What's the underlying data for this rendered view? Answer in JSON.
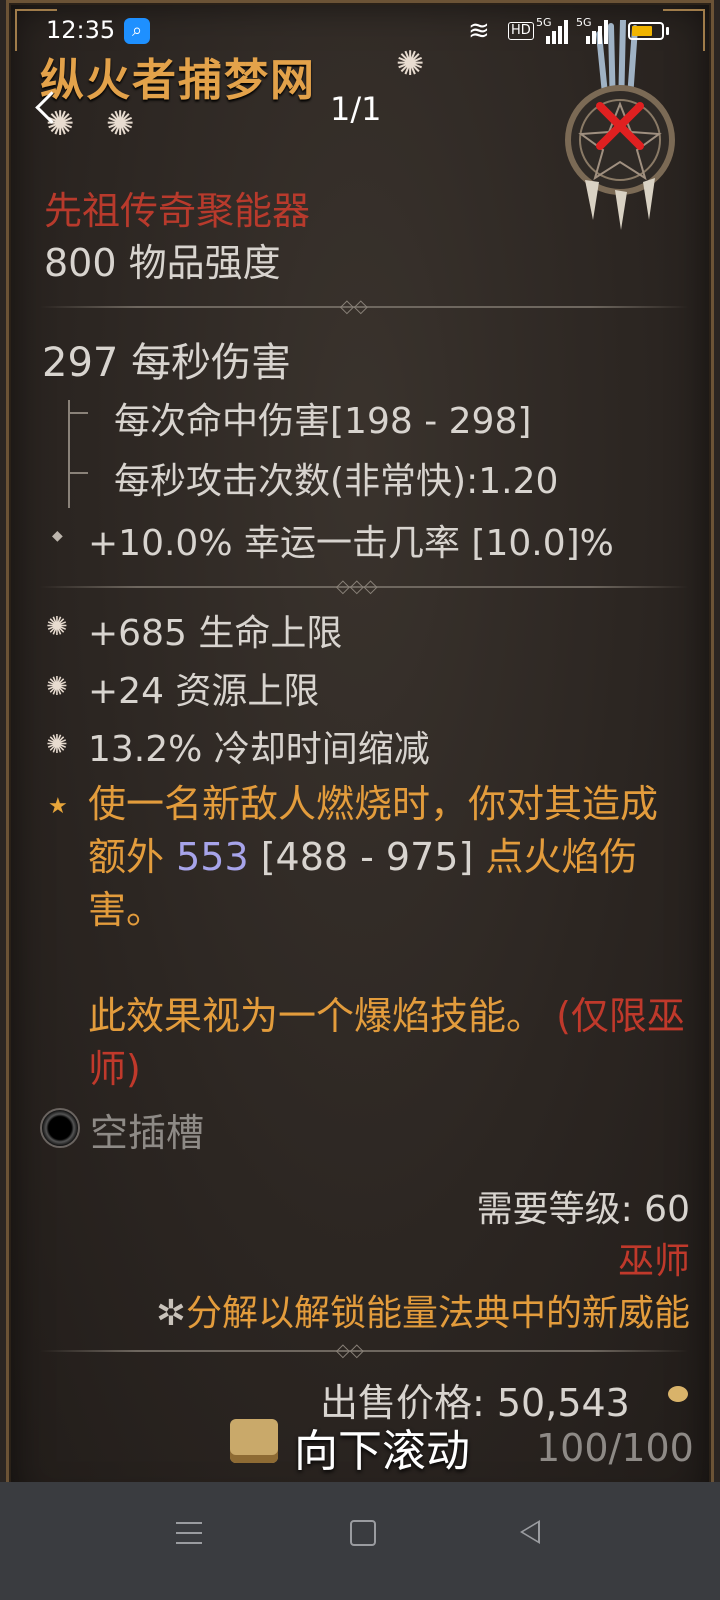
{
  "status_bar": {
    "time": "12:35",
    "network_badge": "HD",
    "signal1_label": "5G",
    "signal2_label": "5G",
    "battery_level": 0.7
  },
  "viewer": {
    "page_counter": "1/1"
  },
  "item": {
    "name": "纵火者捕梦网",
    "rarity": "先祖传奇聚能器",
    "item_power": "800 物品强度",
    "dps": "297 每秒伤害",
    "damage_per_hit": "每次命中伤害[198 - 298]",
    "attack_speed": "每秒攻击次数(非常快):1.20",
    "lucky_hit": "+10.0% 幸运一击几率 [10.0]%",
    "affixes": [
      "+685 生命上限",
      "+24 资源上限",
      "13.2% 冷却时间缩减"
    ],
    "legendary": {
      "part1": "使一名新敌人燃烧时，你对其造成额外 ",
      "value": "553",
      "range": " [488 - 975]",
      "part2": " 点火焰伤害。",
      "line2": "此效果视为一个爆焰技能。",
      "class_note": "(仅限巫师)"
    },
    "socket": "空插槽",
    "required_level": "需要等级: 60",
    "required_class": "巫师",
    "salvage_note": "分解以解锁能量法典中的新威能",
    "sell_price": "出售价格:  50,543",
    "durability": "100/100"
  },
  "overlay": {
    "scroll_hint": "向下滚动"
  },
  "colors": {
    "title": "#e3a24a",
    "rarity": "#b83a2c",
    "legendary": "#e39c3c",
    "value_highlight": "#a7a4ea",
    "class_red": "#c0392b"
  }
}
